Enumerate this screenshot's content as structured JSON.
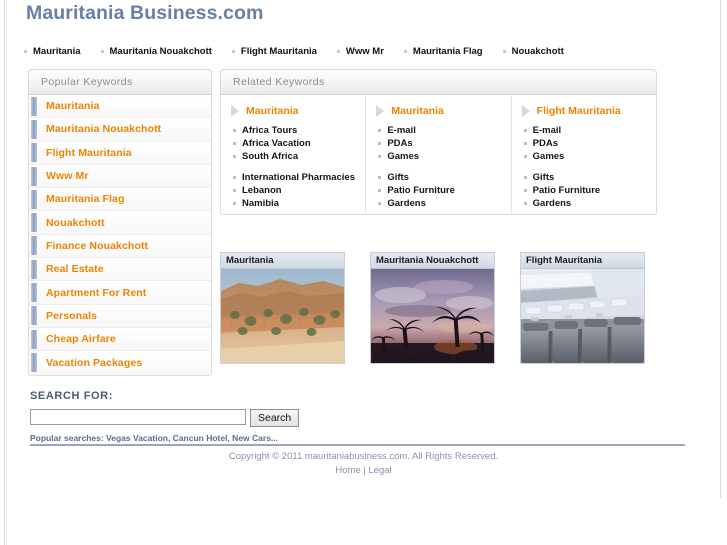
{
  "site": {
    "title": "Mauritania Business.com"
  },
  "nav": {
    "items": [
      {
        "label": "Mauritania"
      },
      {
        "label": "Mauritania Nouakchott"
      },
      {
        "label": "Flight Mauritania"
      },
      {
        "label": "Www Mr"
      },
      {
        "label": "Mauritania Flag"
      },
      {
        "label": "Nouakchott"
      }
    ]
  },
  "sidebar": {
    "header": "Popular Keywords",
    "items": [
      {
        "label": "Mauritania"
      },
      {
        "label": "Mauritania Nouakchott"
      },
      {
        "label": "Flight Mauritania"
      },
      {
        "label": "Www Mr"
      },
      {
        "label": "Mauritania Flag"
      },
      {
        "label": "Nouakchott"
      },
      {
        "label": "Finance Nouakchott"
      },
      {
        "label": "Real Estate"
      },
      {
        "label": "Apartment For Rent"
      },
      {
        "label": "Personals"
      },
      {
        "label": "Cheap Airfare"
      },
      {
        "label": "Vacation Packages"
      }
    ]
  },
  "related": {
    "header": "Related Keywords",
    "columns": [
      {
        "title": "Mauritania",
        "group1": [
          "Africa Tours",
          "Africa Vacation",
          "South Africa"
        ],
        "group2": [
          "International Pharmacies",
          "Lebanon",
          "Namibia"
        ]
      },
      {
        "title": "Mauritania",
        "group1": [
          "E-mail",
          "PDAs",
          "Games"
        ],
        "group2": [
          "Gifts",
          "Patio Furniture",
          "Gardens"
        ]
      },
      {
        "title": "Flight Mauritania",
        "group1": [
          "E-mail",
          "PDAs",
          "Games"
        ],
        "group2": [
          "Gifts",
          "Patio Furniture",
          "Gardens"
        ]
      }
    ]
  },
  "cards": [
    {
      "title": "Mauritania",
      "image": "canyon-desert-photo"
    },
    {
      "title": "Mauritania Nouakchott",
      "image": "palm-sunset-photo"
    },
    {
      "title": "Flight Mauritania",
      "image": "airplane-cabin-photo"
    }
  ],
  "search": {
    "label": "SEARCH FOR:",
    "value": "",
    "placeholder": "",
    "button": "Search",
    "popular": "Popular searches: Vegas Vacation, Cancun Hotel, New Cars..."
  },
  "footer": {
    "copyright": "Copyright © 2011 mauritaniabusiness.com. All Rights Reserved.",
    "home": "Home",
    "separator": " | ",
    "legal": "Legal"
  },
  "colors": {
    "title": "#6a7fa8",
    "link_orange": "#ef8200",
    "footer_text": "#8792ab",
    "marker_blue": "#8ea0c0"
  }
}
